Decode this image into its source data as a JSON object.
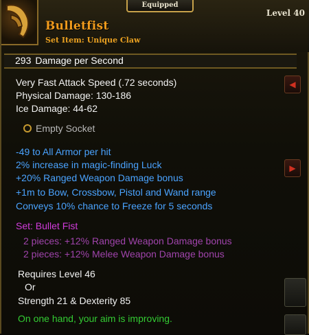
{
  "header": {
    "equipped_label": "Equipped",
    "item_name": "Bulletfist",
    "item_type": "Set Item: Unique Claw",
    "level": "Level 40"
  },
  "dps": {
    "value": "293",
    "label": "Damage per Second"
  },
  "base_stats": [
    "Very Fast Attack Speed (.72 seconds)",
    "Physical Damage: 130-186",
    "Ice Damage: 44-62"
  ],
  "socket": {
    "label": "Empty Socket"
  },
  "magic_props": [
    "-49 to All Armor per hit",
    "2% increase in magic-finding Luck",
    "+20% Ranged Weapon Damage bonus",
    "+1m to Bow, Crossbow, Pistol and Wand range",
    "Conveys 10% chance to Freeze for 5 seconds"
  ],
  "set": {
    "title": "Set: Bullet Fist",
    "bonuses": [
      "2 pieces: +12% Ranged Weapon Damage bonus",
      "2 pieces: +12% Melee Weapon Damage bonus"
    ]
  },
  "requirements": {
    "level": "Requires Level 46",
    "or": "Or",
    "stats": "Strength 21 & Dexterity 85"
  },
  "flavor": "On one hand, your aim is improving.",
  "colors": {
    "item_name": "#f09a1c",
    "magic": "#4aa3ff",
    "set": "#d23cdc",
    "flavor": "#33cc33"
  },
  "icons": {
    "item": "claw-item-icon",
    "socket": "socket-ring-icon",
    "scroll_left": "arrow-left-icon",
    "scroll_right": "arrow-right-icon"
  }
}
